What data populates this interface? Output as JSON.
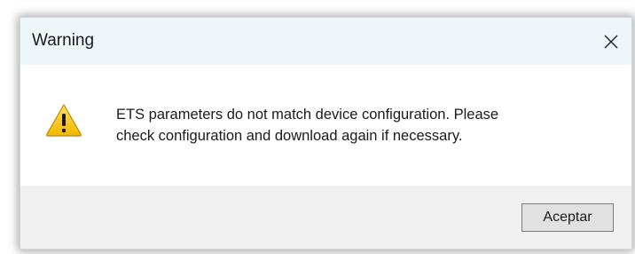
{
  "dialog": {
    "title": "Warning",
    "close_icon": "close-icon",
    "icon": "warning-triangle-icon",
    "message_line1": "ETS parameters do not match device configuration. Please",
    "message_line2": "check configuration and download again if necessary.",
    "ok_label": "Aceptar"
  },
  "colors": {
    "titlebar": "#eef6f9",
    "footer": "#f0f0f0",
    "warning_yellow": "#f8c600",
    "button_bg": "#e1e1e1"
  }
}
